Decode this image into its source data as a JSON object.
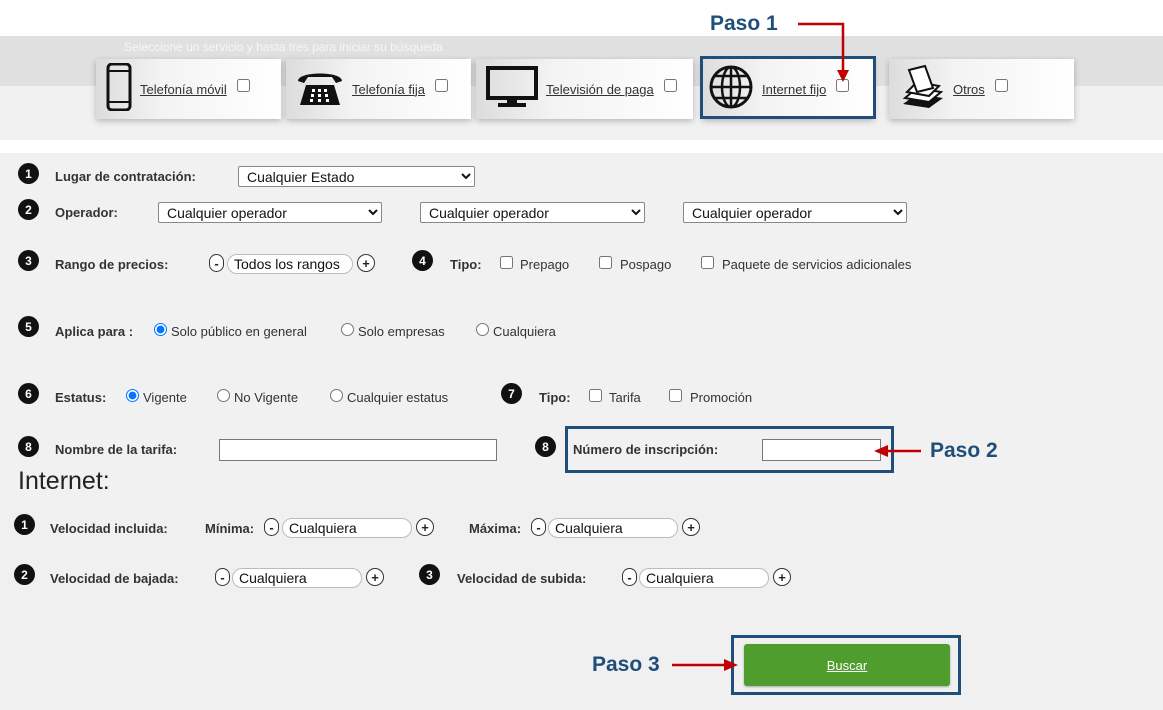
{
  "band": {
    "title": "Seleccione un servicio y hasta tres para iniciar su búsqueda"
  },
  "services": [
    {
      "label": "Telefonía móvil",
      "icon": "mobile-phone-icon"
    },
    {
      "label": "Telefonía fija",
      "icon": "landline-phone-icon"
    },
    {
      "label": "Televisión de paga",
      "icon": "television-icon"
    },
    {
      "label": "Internet fijo",
      "icon": "globe-icon"
    },
    {
      "label": "Otros",
      "icon": "stack-papers-icon"
    }
  ],
  "form": {
    "n1": "1",
    "n2": "2",
    "n3": "3",
    "n4": "4",
    "n5": "5",
    "n6": "6",
    "n7": "7",
    "n8a": "8",
    "n8b": "8",
    "lugar_label": "Lugar de contratación:",
    "lugar_value": "Cualquier Estado",
    "operador_label": "Operador:",
    "operador_values": [
      "Cualquier operador",
      "Cualquier operador",
      "Cualquier operador"
    ],
    "rango_label": "Rango de precios:",
    "rango_value": "Todos los rangos",
    "tipo_label": "Tipo:",
    "tipo_options": [
      "Prepago",
      "Pospago",
      "Paquete de servicios adicionales"
    ],
    "aplica_label": "Aplica para :",
    "aplica_options": [
      "Solo público en general",
      "Solo empresas",
      "Cualquiera"
    ],
    "estatus_label": "Estatus:",
    "estatus_options": [
      "Vigente",
      "No Vigente",
      "Cualquier estatus"
    ],
    "tipo2_label": "Tipo:",
    "tipo2_options": [
      "Tarifa",
      "Promoción"
    ],
    "nombre_label": "Nombre de la tarifa:",
    "inscripcion_label": "Número de inscripción:"
  },
  "internet": {
    "title": "Internet:",
    "n1": "1",
    "n2": "2",
    "n3": "3",
    "velocidad_incluida_label": "Velocidad incluida:",
    "minima_label": "Mínima:",
    "minima_value": "Cualquiera",
    "maxima_label": "Máxima:",
    "maxima_value": "Cualquiera",
    "bajada_label": "Velocidad de bajada:",
    "bajada_value": "Cualquiera",
    "subida_label": "Velocidad de subida:",
    "subida_value": "Cualquiera",
    "minus": "-",
    "plus": "+"
  },
  "search_button": "Buscar",
  "annotations": {
    "paso1": "Paso 1",
    "paso2": "Paso 2",
    "paso3": "Paso 3",
    "box_color": "#1f4e79",
    "arrow_color": "#c00000"
  }
}
